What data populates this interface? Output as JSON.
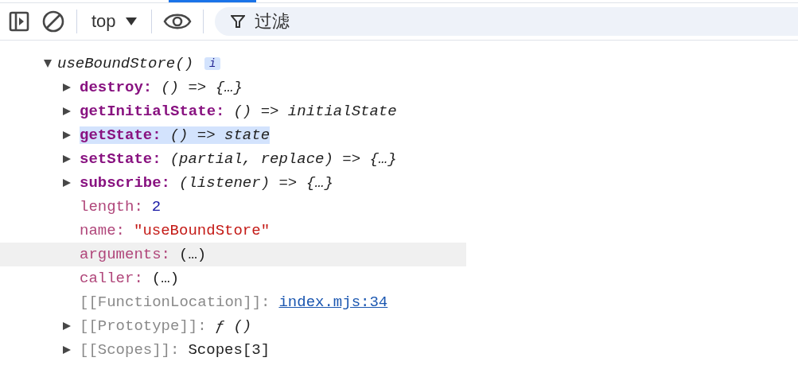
{
  "toolbar": {
    "context": "top",
    "filter": {
      "placeholder": "过滤"
    }
  },
  "root": {
    "label": "useBoundStore()",
    "badge": "i",
    "expanded": true,
    "children": [
      {
        "key": {
          "text": "destroy:",
          "kind": "own"
        },
        "value": {
          "text": "() => {…}",
          "kind": "function"
        },
        "expandable": true,
        "selected": false,
        "hovered": false
      },
      {
        "key": {
          "text": "getInitialState:",
          "kind": "own"
        },
        "value": {
          "text": "() => initialState",
          "kind": "function"
        },
        "expandable": true,
        "selected": false,
        "hovered": false
      },
      {
        "key": {
          "text": "getState:",
          "kind": "own"
        },
        "value": {
          "text": "() => state",
          "kind": "function"
        },
        "expandable": true,
        "selected": true,
        "hovered": false
      },
      {
        "key": {
          "text": "setState:",
          "kind": "own"
        },
        "value": {
          "text": "(partial, replace) => {…}",
          "kind": "function"
        },
        "expandable": true,
        "selected": false,
        "hovered": false
      },
      {
        "key": {
          "text": "subscribe:",
          "kind": "own"
        },
        "value": {
          "text": "(listener) => {…}",
          "kind": "function"
        },
        "expandable": true,
        "selected": false,
        "hovered": false
      },
      {
        "key": {
          "text": "length:",
          "kind": "builtin"
        },
        "value": {
          "text": "2",
          "kind": "number"
        },
        "expandable": false,
        "selected": false,
        "hovered": false
      },
      {
        "key": {
          "text": "name:",
          "kind": "builtin"
        },
        "value": {
          "text": "\"useBoundStore\"",
          "kind": "string"
        },
        "expandable": false,
        "selected": false,
        "hovered": false
      },
      {
        "key": {
          "text": "arguments:",
          "kind": "builtin"
        },
        "value": {
          "text": "(…)",
          "kind": "getter"
        },
        "expandable": false,
        "selected": false,
        "hovered": true
      },
      {
        "key": {
          "text": "caller:",
          "kind": "builtin"
        },
        "value": {
          "text": "(…)",
          "kind": "getter"
        },
        "expandable": false,
        "selected": false,
        "hovered": false
      },
      {
        "key": {
          "text": "[[FunctionLocation]]:",
          "kind": "internal"
        },
        "value": {
          "text": "index.mjs:34",
          "kind": "link"
        },
        "expandable": false,
        "selected": false,
        "hovered": false
      },
      {
        "key": {
          "text": "[[Prototype]]:",
          "kind": "internal"
        },
        "value": {
          "text": "ƒ ()",
          "kind": "function"
        },
        "expandable": true,
        "selected": false,
        "hovered": false
      },
      {
        "key": {
          "text": "[[Scopes]]:",
          "kind": "internal"
        },
        "value": {
          "text": "Scopes[3]",
          "kind": "object"
        },
        "expandable": true,
        "selected": false,
        "hovered": false
      }
    ]
  }
}
